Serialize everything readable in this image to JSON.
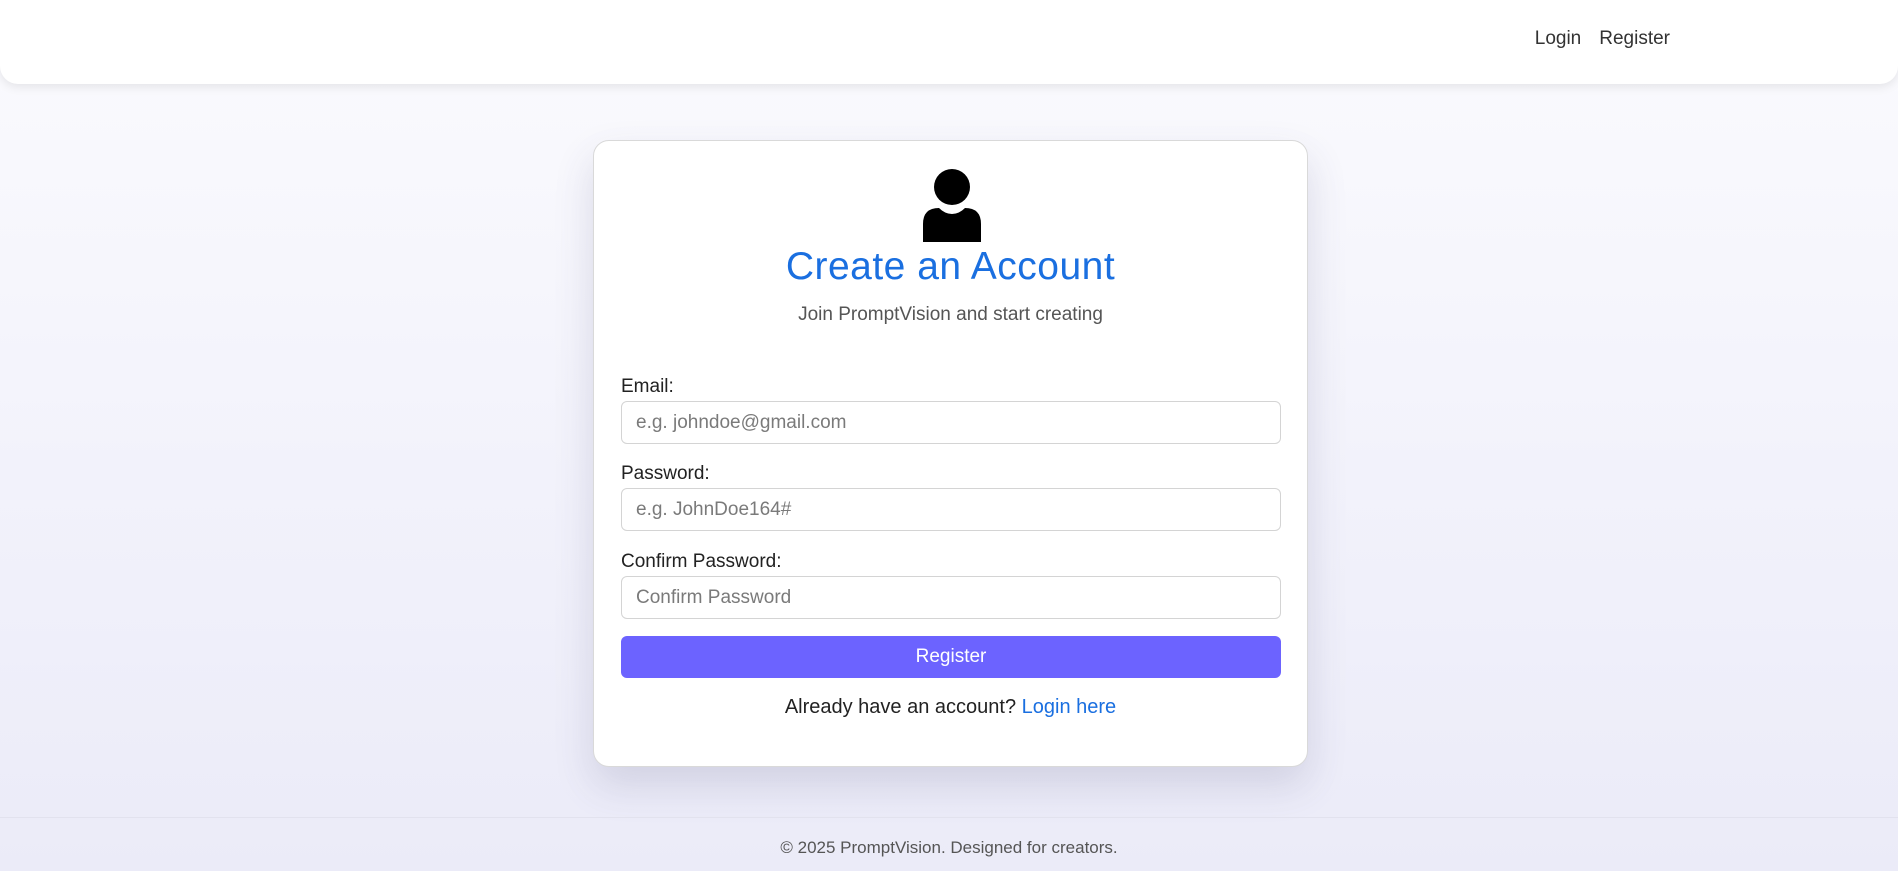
{
  "nav": {
    "login_label": "Login",
    "register_label": "Register"
  },
  "card": {
    "icon": "user-icon",
    "title": "Create an Account",
    "subtitle": "Join PromptVision and start creating"
  },
  "form": {
    "email_label": "Email:",
    "email_placeholder": "e.g. johndoe@gmail.com",
    "email_value": "",
    "password_label": "Password:",
    "password_placeholder": "e.g. JohnDoe164#",
    "password_value": "",
    "confirm_label": "Confirm Password:",
    "confirm_placeholder": "Confirm Password",
    "confirm_value": "",
    "submit_label": "Register"
  },
  "login_prompt": {
    "text": "Already have an account?",
    "link_label": "Login here"
  },
  "footer": {
    "text": "© 2025 PromptVision. Designed for creators."
  },
  "colors": {
    "accent": "#1a6fe0",
    "button": "#6c63ff"
  }
}
